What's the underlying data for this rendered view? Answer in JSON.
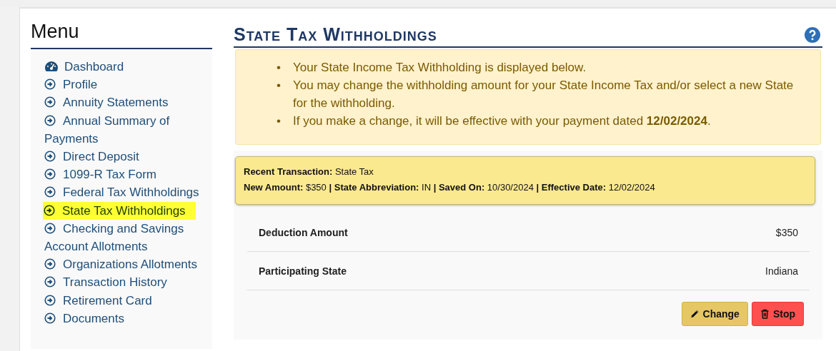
{
  "menu": {
    "title": "Menu",
    "items": [
      {
        "label": "Dashboard",
        "kind": "dashboard",
        "selected": false
      },
      {
        "label": "Profile",
        "kind": "link",
        "selected": false
      },
      {
        "label": "Annuity Statements",
        "kind": "link",
        "selected": false
      },
      {
        "label": "Annual Summary of Payments",
        "kind": "link",
        "selected": false
      },
      {
        "label": "Direct Deposit",
        "kind": "link",
        "selected": false
      },
      {
        "label": "1099-R Tax Form",
        "kind": "link",
        "selected": false
      },
      {
        "label": "Federal Tax Withholdings",
        "kind": "link",
        "selected": false
      },
      {
        "label": "State Tax Withholdings",
        "kind": "link",
        "selected": true
      },
      {
        "label": "Checking and Savings Account Allotments",
        "kind": "link",
        "selected": false
      },
      {
        "label": "Organizations Allotments",
        "kind": "link",
        "selected": false
      },
      {
        "label": "Transaction History",
        "kind": "link",
        "selected": false
      },
      {
        "label": "Retirement Card",
        "kind": "link",
        "selected": false
      },
      {
        "label": "Documents",
        "kind": "link",
        "selected": false
      }
    ]
  },
  "page": {
    "title": "State Tax Withholdings",
    "notices": [
      {
        "bullet": "•",
        "text": "Your State Income Tax Withholding is displayed below."
      },
      {
        "bullet": "•",
        "text": "You may change the withholding amount for your State Income Tax and/or select a new State for the withholding."
      },
      {
        "bullet": "•",
        "text": "If you make a change, it will be effective with your payment dated **12/02/2024**."
      }
    ],
    "recent_transaction": [
      "**Recent Transaction:** State Tax",
      "**New Amount:** $350 **|** **State Abbreviation:** IN **|** **Saved On:** 10/30/2024 **|** **Effective Date:** 12/02/2024"
    ],
    "details": [
      {
        "label": "Deduction Amount",
        "value": "$350"
      },
      {
        "label": "Participating State",
        "value": "Indiana"
      }
    ],
    "buttons": [
      {
        "label": "Change",
        "kind": "change"
      },
      {
        "label": "Stop",
        "kind": "stop"
      }
    ]
  }
}
